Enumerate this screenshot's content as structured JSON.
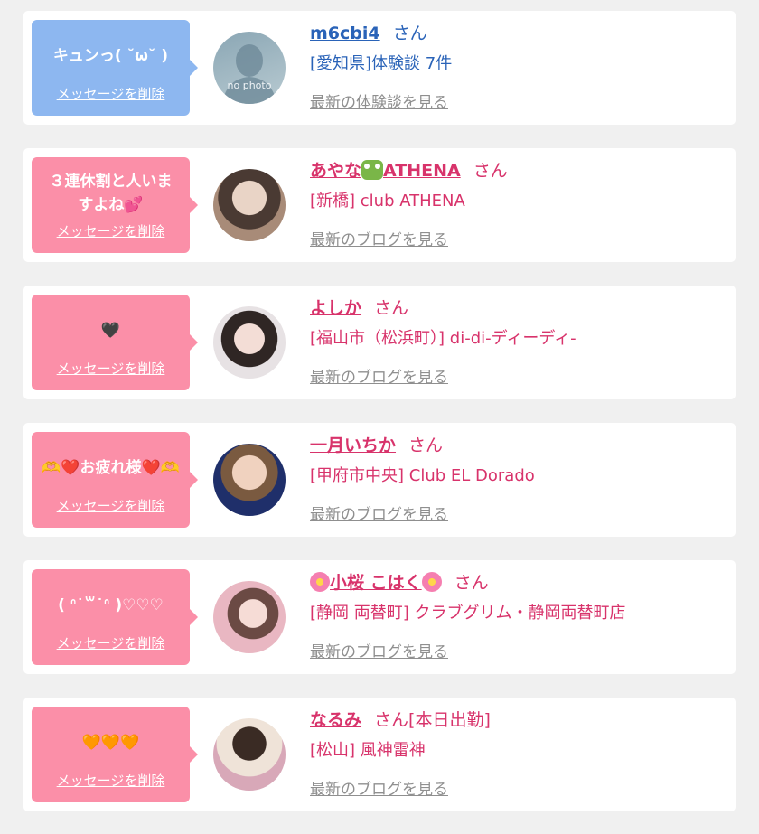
{
  "delete_label": "メッセージを削除",
  "san_label": "さん",
  "cards": [
    {
      "message": "キュンっ( ˘ω˘ )",
      "name": "m6cbi4",
      "suffix": "",
      "shop": "[愛知県]体験談 7件",
      "link": "最新の体験談を見る",
      "avatar_label": "no photo",
      "avatar_icon": "silhouette-avatar"
    },
    {
      "message": "３連休割と人いますよね💕",
      "name": "あやな",
      "name_icon": "dragon-icon",
      "name_tail": "ATHENA",
      "suffix": "",
      "shop": "[新橋] club ATHENA",
      "link": "最新のブログを見る"
    },
    {
      "message": "🖤",
      "name": "よしか",
      "suffix": "",
      "shop": "[福山市（松浜町）] di-di-ディーディ-",
      "link": "最新のブログを見る"
    },
    {
      "message": "🫶❤️お疲れ様❤️🫶",
      "name": "一月いちか",
      "suffix": "",
      "shop": "[甲府市中央] Club EL Dorado",
      "link": "最新のブログを見る"
    },
    {
      "message": "( ᐢ˙꒳˙ᐢ )♡♡♡",
      "name": "小桜 こはく",
      "name_icon": "cherry-blossom-icon",
      "suffix": "",
      "shop": "[静岡 両替町] クラブグリム・静岡両替町店",
      "link": "最新のブログを見る"
    },
    {
      "message": "🧡🧡🧡",
      "name": "なるみ",
      "suffix": "[本日出勤]",
      "shop": "[松山] 風神雷神",
      "link": "最新のブログを見る"
    }
  ],
  "colors": {
    "background": "#f0f0f0",
    "bubble_blue": "#8db7f0",
    "bubble_pink": "#fb8fa8",
    "text_blue": "#2a63b8",
    "text_pink": "#d8336b",
    "link_gray": "#8f8f8f"
  }
}
